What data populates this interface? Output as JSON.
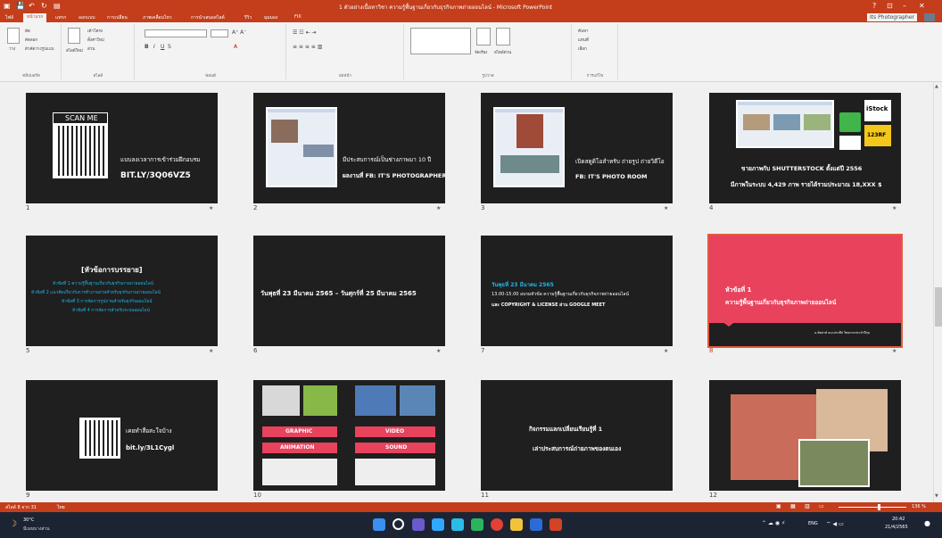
{
  "window": {
    "title": "1 ตัวอย่างเนื้อหาวิชา ความรู้พื้นฐานเกี่ยวกับธุรกิจภาพถ่ายออนไลน์ - Microsoft PowerPoint",
    "controls": [
      "?",
      "⊡",
      "–",
      "✕"
    ]
  },
  "ribbon": {
    "tabs": [
      "ไฟล์",
      "หน้าแรก",
      "แทรก",
      "ออกแบบ",
      "การเปลี่ยน",
      "ภาพเคลื่อนไหว",
      "การนำเสนอสไลด์",
      "รีวิว",
      "มุมมอง",
      "FIX"
    ],
    "active_tab": "หน้าแรก",
    "user": "Its Photographer",
    "groups": [
      "คลิปบอร์ด",
      "สไลด์",
      "ฟอนต์",
      "ย่อหน้า",
      "รูปวาด",
      "การแก้ไข"
    ],
    "paste": "วาง",
    "cut": "ตัด",
    "copy": "คัดลอก",
    "format_painter": "ตัวคัดวางรูปแบบ",
    "new_slide": "สไลด์ใหม่",
    "layout": "เค้าโครง",
    "reset": "ตั้งค่าใหม่",
    "section": "ส่วน",
    "find": "ค้นหา",
    "replace": "แทนที่",
    "select": "เลือก",
    "arrange": "จัดเรียง",
    "quick_styles": "สไตล์ด่วน"
  },
  "slides": [
    {
      "num": "1",
      "badge": "SCAN ME",
      "line1": "แบบลงเวลาการเข้าร่วมฝึกอบรม",
      "line2": "BIT.LY/3Q06VZ5"
    },
    {
      "num": "2",
      "line1": "มีประสบการณ์เป็นช่างภาพมา 10 ปี",
      "line2": "ผลงานที่ FB: IT'S PHOTOGRAPHER"
    },
    {
      "num": "3",
      "line1": "เปิดสตูดิโอสำหรับ ถ่ายรูป ถ่ายวิดีโอ",
      "line2": "FB: IT'S PHOTO ROOM"
    },
    {
      "num": "4",
      "line1": "ขายภาพกับ SHUTTERSTOCK ตั้งแต่ปี 2556",
      "line2": "มีภาพในระบบ 4,429 ภาพ รายได้รวมประมาณ 18,XXX $",
      "logo1": "iStock",
      "logo2": "123RF"
    },
    {
      "num": "5",
      "heading": "[หัวข้อการบรรยาย]",
      "items": [
        "หัวข้อที่ 1 ความรู้พื้นฐานเกี่ยวกับธุรกิจภาพถ่ายออนไลน์",
        "หัวข้อที่ 2 แนวคิดเกี่ยวกับการทำภาพถ่ายสำหรับธุรกิจภาพถ่ายออนไลน์",
        "หัวข้อที่ 3 การจัดการรูปภาพสำหรับธุรกิจออนไลน์",
        "หัวข้อที่ 4 การจัดการสำหรับระบบออนไลน์"
      ]
    },
    {
      "num": "6",
      "line1": "วันพุธที่ 23 มีนาคม 2565 – วันศุกร์ที่ 25 มีนาคม 2565"
    },
    {
      "num": "7",
      "line1": "วันพุธที่ 23 มีนาคม 2565",
      "line2": "13.00-15.00 อบรมหัวข้อ ความรู้พื้นฐานเกี่ยวกับธุรกิจภาพถ่ายออนไลน์",
      "line3": "และ COPYRIGHT & LICENSE ผ่าน GOOGLE MEET"
    },
    {
      "num": "8",
      "line1": "หัวข้อที่ 1",
      "line2": "ความรู้พื้นฐานเกี่ยวกับธุรกิจภาพถ่ายออนไลน์",
      "footer": "อ.ชัยสาห์ ธนะประทีป วิทยากรประจำปีรุ่น"
    },
    {
      "num": "9",
      "line1": "เคยทำสื่อสะใจบ้าง",
      "line2": "bit.ly/3L1Cygl"
    },
    {
      "num": "10",
      "labels": [
        "GRAPHIC",
        "VIDEO",
        "ANIMATION",
        "SOUND"
      ]
    },
    {
      "num": "11",
      "line1": "กิจกรรมแลกเปลี่ยนเรียนรู้ที่ 1",
      "line2": "เล่าประสบการณ์ถ่ายภาพของตนเอง"
    },
    {
      "num": "12"
    }
  ],
  "status": {
    "left": "สไลด์ 8 จาก 31",
    "lang": "ไทย",
    "zoom": "136 %"
  },
  "taskbar": {
    "weather_temp": "30°C",
    "weather_desc": "มีเมฆบางส่วน",
    "lang": "ENG",
    "time": "20:42",
    "date": "21/4/2565"
  },
  "colors": {
    "accent": "#c43e1c",
    "slide_bg": "#1f1f1f",
    "highlight": "#21b4e8",
    "pink": "#e8425d"
  }
}
